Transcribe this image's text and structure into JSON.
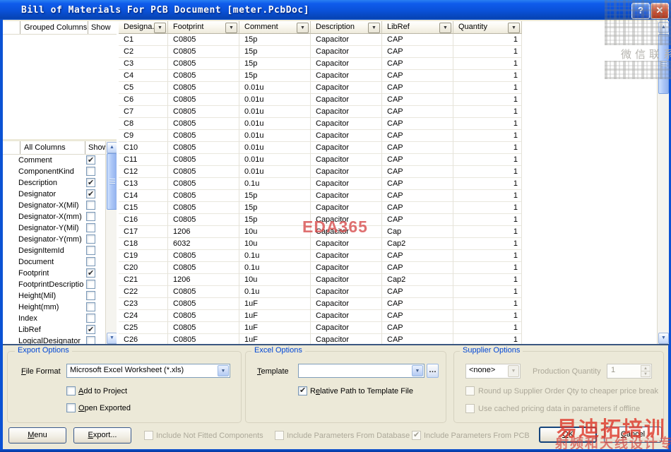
{
  "window": {
    "title": "Bill of Materials For PCB Document [meter.PcbDoc]"
  },
  "titlebar": {
    "help_icon": "?",
    "close_icon": "✕"
  },
  "left": {
    "grouped": {
      "col1": "Grouped Columns",
      "col2": "Show",
      "items": []
    },
    "all_columns": {
      "col1": "All Columns",
      "col2": "Show",
      "items": [
        {
          "label": "Comment",
          "show": true
        },
        {
          "label": "ComponentKind",
          "show": false
        },
        {
          "label": "Description",
          "show": true
        },
        {
          "label": "Designator",
          "show": true
        },
        {
          "label": "Designator-X(Mil)",
          "show": false
        },
        {
          "label": "Designator-X(mm)",
          "show": false
        },
        {
          "label": "Designator-Y(Mil)",
          "show": false
        },
        {
          "label": "Designator-Y(mm)",
          "show": false
        },
        {
          "label": "DesignItemId",
          "show": false
        },
        {
          "label": "Document",
          "show": false
        },
        {
          "label": "Footprint",
          "show": true
        },
        {
          "label": "FootprintDescriptio",
          "show": false
        },
        {
          "label": "Height(Mil)",
          "show": false
        },
        {
          "label": "Height(mm)",
          "show": false
        },
        {
          "label": "Index",
          "show": false
        },
        {
          "label": "LibRef",
          "show": true
        },
        {
          "label": "LogicalDesignator",
          "show": false
        }
      ]
    }
  },
  "table": {
    "columns": [
      "Designa...",
      "Footprint",
      "Comment",
      "Description",
      "LibRef",
      "Quantity"
    ],
    "filter_icon": "▼",
    "rows": [
      [
        "C1",
        "C0805",
        "15p",
        "Capacitor",
        "CAP",
        "1"
      ],
      [
        "C2",
        "C0805",
        "15p",
        "Capacitor",
        "CAP",
        "1"
      ],
      [
        "C3",
        "C0805",
        "15p",
        "Capacitor",
        "CAP",
        "1"
      ],
      [
        "C4",
        "C0805",
        "15p",
        "Capacitor",
        "CAP",
        "1"
      ],
      [
        "C5",
        "C0805",
        "0.01u",
        "Capacitor",
        "CAP",
        "1"
      ],
      [
        "C6",
        "C0805",
        "0.01u",
        "Capacitor",
        "CAP",
        "1"
      ],
      [
        "C7",
        "C0805",
        "0.01u",
        "Capacitor",
        "CAP",
        "1"
      ],
      [
        "C8",
        "C0805",
        "0.01u",
        "Capacitor",
        "CAP",
        "1"
      ],
      [
        "C9",
        "C0805",
        "0.01u",
        "Capacitor",
        "CAP",
        "1"
      ],
      [
        "C10",
        "C0805",
        "0.01u",
        "Capacitor",
        "CAP",
        "1"
      ],
      [
        "C11",
        "C0805",
        "0.01u",
        "Capacitor",
        "CAP",
        "1"
      ],
      [
        "C12",
        "C0805",
        "0.01u",
        "Capacitor",
        "CAP",
        "1"
      ],
      [
        "C13",
        "C0805",
        "0.1u",
        "Capacitor",
        "CAP",
        "1"
      ],
      [
        "C14",
        "C0805",
        "15p",
        "Capacitor",
        "CAP",
        "1"
      ],
      [
        "C15",
        "C0805",
        "15p",
        "Capacitor",
        "CAP",
        "1"
      ],
      [
        "C16",
        "C0805",
        "15p",
        "Capacitor",
        "CAP",
        "1"
      ],
      [
        "C17",
        "1206",
        "10u",
        "Capacitor",
        "Cap",
        "1"
      ],
      [
        "C18",
        "6032",
        "10u",
        "Capacitor",
        "Cap2",
        "1"
      ],
      [
        "C19",
        "C0805",
        "0.1u",
        "Capacitor",
        "CAP",
        "1"
      ],
      [
        "C20",
        "C0805",
        "0.1u",
        "Capacitor",
        "CAP",
        "1"
      ],
      [
        "C21",
        "1206",
        "10u",
        "Capacitor",
        "Cap2",
        "1"
      ],
      [
        "C22",
        "C0805",
        "0.1u",
        "Capacitor",
        "CAP",
        "1"
      ],
      [
        "C23",
        "C0805",
        "1uF",
        "Capacitor",
        "CAP",
        "1"
      ],
      [
        "C24",
        "C0805",
        "1uF",
        "Capacitor",
        "CAP",
        "1"
      ],
      [
        "C25",
        "C0805",
        "1uF",
        "Capacitor",
        "CAP",
        "1"
      ],
      [
        "C26",
        "C0805",
        "1uF",
        "Capacitor",
        "CAP",
        "1"
      ]
    ]
  },
  "export_options": {
    "title": "Export Options",
    "file_format_label": "&File Format",
    "file_format_value": "Microsoft Excel Worksheet (*.xls)",
    "add_to_project": {
      "label": "&Add to Project",
      "checked": false
    },
    "open_exported": {
      "label": "&Open Exported",
      "checked": false
    }
  },
  "excel_options": {
    "title": "Excel Options",
    "template_label": "&Template",
    "template_value": "",
    "browse_label": "…",
    "relative_path": {
      "label": "R&elative Path to Template File",
      "checked": true
    }
  },
  "supplier_options": {
    "title": "Supplier Options",
    "supplier_value": "<none>",
    "production_quantity_label": "Production Quantity",
    "production_quantity_value": "1",
    "round_up": {
      "label": "Round up Supplier Order Qty to cheaper price break",
      "checked": false
    },
    "use_cached": {
      "label": "Use cached pricing data in parameters if offline",
      "checked": false
    }
  },
  "bottom_bar": {
    "menu_label": "&Menu",
    "export_label": "&Export...",
    "include_not_fitted": {
      "label": "Include Not Fitted Components",
      "checked": false
    },
    "include_params_database": {
      "label": "Include Parameters From Database",
      "checked": false
    },
    "include_params_pcb": {
      "label": "Include Parameters From PCB",
      "checked": true
    },
    "ok_label": "&OK",
    "cancel_label": "&Cancel"
  },
  "watermarks": {
    "eda": "EDA365",
    "wechat": "微信联系",
    "brand": "易迪拓培训",
    "slogan": "射频和天线设计专家"
  },
  "colors": {
    "title_blue": "#0b52d4",
    "group_label_blue": "#0046d5",
    "watermark_red": "#de3a2c",
    "disabled_text": "#aca899"
  }
}
